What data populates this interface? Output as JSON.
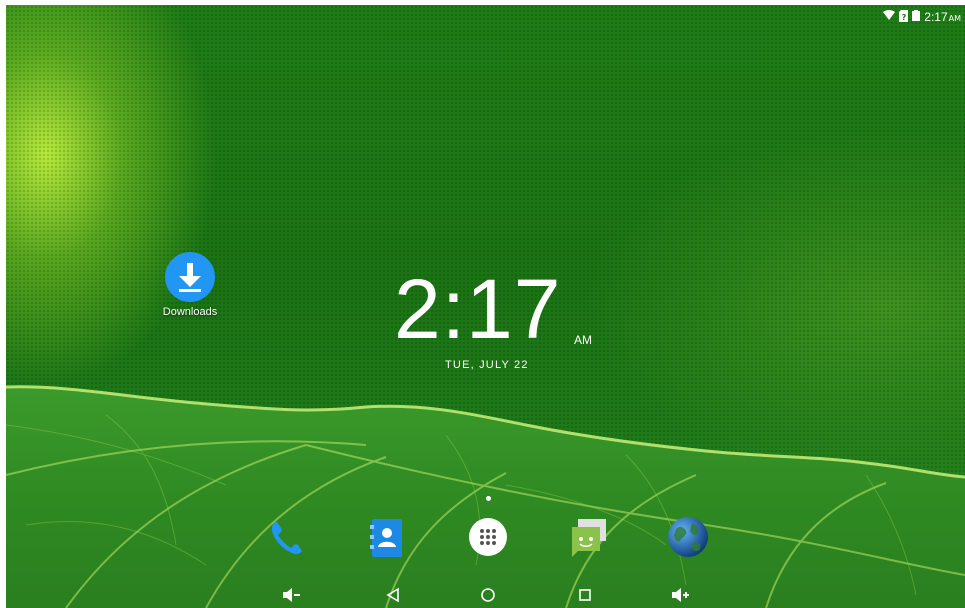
{
  "status_bar": {
    "time": "2:17",
    "ampm": "AM",
    "icons": [
      "wifi-icon",
      "sim-card-icon",
      "battery-icon"
    ]
  },
  "clock_widget": {
    "time": "2:17",
    "ampm": "AM",
    "date": "TUE, JULY 22"
  },
  "desktop_icons": [
    {
      "name": "downloads-icon",
      "label": "Downloads",
      "color": "#2196F3"
    }
  ],
  "dock": [
    {
      "name": "phone-icon"
    },
    {
      "name": "contacts-icon"
    },
    {
      "name": "app-drawer-icon"
    },
    {
      "name": "messaging-icon"
    },
    {
      "name": "browser-globe-icon"
    }
  ],
  "nav_bar": [
    "volume-down-icon",
    "back-icon",
    "home-icon",
    "recents-icon",
    "volume-up-icon"
  ],
  "colors": {
    "wallpaper_base": "#1b7414",
    "wallpaper_highlight": "#a8e03a",
    "downloads_accent": "#2196F3",
    "contacts_accent": "#1E88E5",
    "messaging_accent": "#8BC34A"
  }
}
